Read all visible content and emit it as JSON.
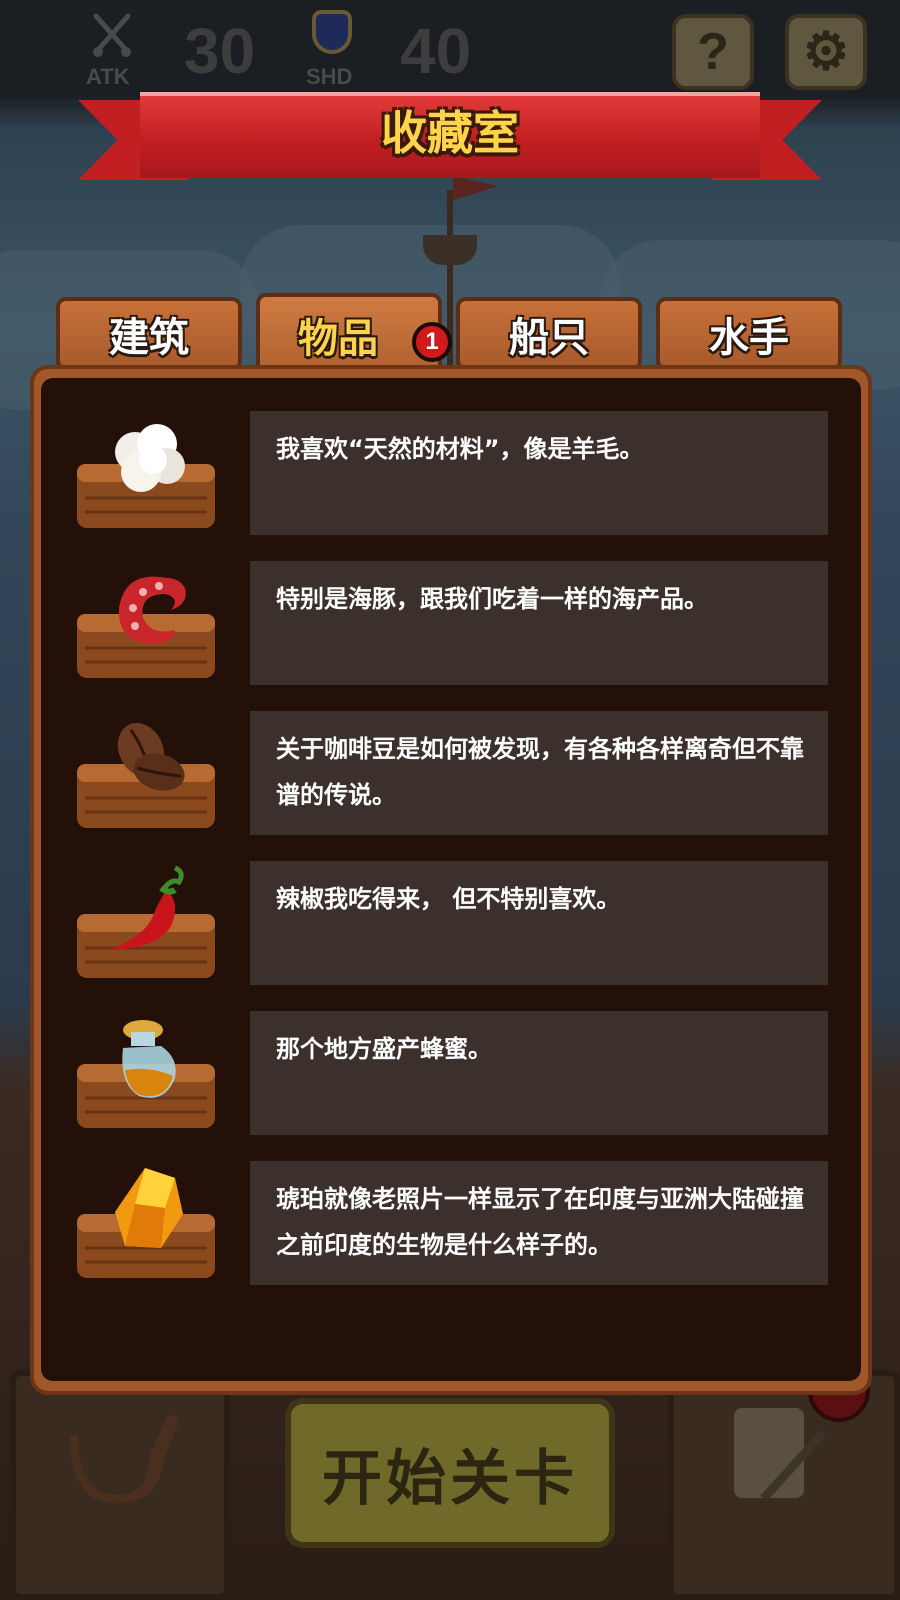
{
  "hud": {
    "atk_label": "ATK",
    "atk_value": "30",
    "shd_label": "SHD",
    "shd_value": "40",
    "help_symbol": "?",
    "settings_symbol": "⚙"
  },
  "title": "收藏室",
  "tabs": [
    {
      "label": "建筑",
      "active": false
    },
    {
      "label": "物品",
      "active": true,
      "badge": "1"
    },
    {
      "label": "船只",
      "active": false
    },
    {
      "label": "水手",
      "active": false
    }
  ],
  "items": [
    {
      "icon": "wool-icon",
      "text": "我喜欢“天然的材料”，像是羊毛。"
    },
    {
      "icon": "octopus-tentacle-icon",
      "text": "特别是海豚，跟我们吃着一样的海产品。"
    },
    {
      "icon": "coffee-beans-icon",
      "text": "关于咖啡豆是如何被发现，有各种各样离奇但不靠谱的传说。"
    },
    {
      "icon": "chili-pepper-icon",
      "text": "辣椒我吃得来， 但不特别喜欢。"
    },
    {
      "icon": "honey-jar-icon",
      "text": "那个地方盛产蜂蜜。"
    },
    {
      "icon": "amber-gem-icon",
      "text": "琥珀就像老照片一样显示了在印度与亚洲大陆碰撞之前印度的生物是什么样子的。"
    }
  ],
  "bottom": {
    "start_button_label": "开始关卡"
  },
  "colors": {
    "banner_red": "#c21f22",
    "title_gold": "#ffd34a",
    "panel_brown": "#a0582a",
    "panel_dark": "#231009",
    "row_box": "#3c302c"
  }
}
